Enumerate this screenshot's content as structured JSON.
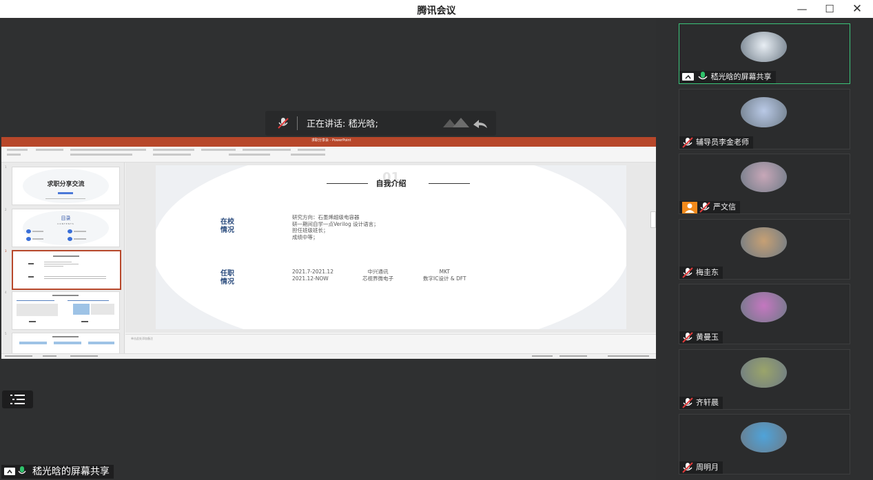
{
  "window": {
    "title": "腾讯会议",
    "controls": {
      "minimize": "—",
      "maximize": "☐",
      "close": "✕"
    }
  },
  "speaking": {
    "text": "正在讲话: 嵇光晗;"
  },
  "presentation": {
    "app_title": "求职分享会 - PowerPoint",
    "tabs": [
      "文件",
      "开始",
      "插入",
      "设计",
      "切换",
      "动画",
      "幻灯片放映",
      "审阅",
      "视图",
      "帮助",
      "操作说明搜索"
    ],
    "thumbnails": [
      {
        "title": "求职分享交流"
      },
      {
        "title": "目录",
        "subtitle": "CONTENTS"
      }
    ],
    "current_slide": {
      "number": "01",
      "heading": "自我介绍",
      "section1": {
        "label_line1": "在校",
        "label_line2": "情况",
        "lines": [
          "研究方向：石墨烯超级电容器",
          "研一期间自学一点Verilog 设计语言；",
          "担任班级班长；",
          "成绩中等；"
        ]
      },
      "section2": {
        "label_line1": "任职",
        "label_line2": "情况",
        "rows": [
          {
            "period": "2021.7-2021.12",
            "company": "中兴通讯",
            "role": "MKT"
          },
          {
            "period": "2021.12-NOW",
            "company": "芯视界微电子",
            "role": "数字IC设计 & DFT"
          }
        ]
      }
    },
    "notes_placeholder": "单击此处添加备注"
  },
  "share_label": "嵇光晗的屏幕共享",
  "participants": [
    {
      "name": "嵇光晗的屏幕共享",
      "muted": false,
      "sharing": true,
      "active": true,
      "avatar_color": "#e8eef4"
    },
    {
      "name": "辅导员李金老师",
      "muted": true,
      "avatar_color": "#b9c9e6"
    },
    {
      "name": "严文信",
      "muted": true,
      "host_badge": true,
      "avatar_color": "#c7a7b8"
    },
    {
      "name": "梅圭东",
      "muted": true,
      "avatar_color": "#c6a074"
    },
    {
      "name": "黄曼玉",
      "muted": true,
      "avatar_color": "#c477c0"
    },
    {
      "name": "齐轩晨",
      "muted": true,
      "avatar_color": "#9aa46a"
    },
    {
      "name": "周明月",
      "muted": true,
      "avatar_color": "#4fa3d9"
    }
  ],
  "colors": {
    "active_border": "#3bc57a",
    "ppt_red": "#b7472a",
    "muted_red": "#e03a3a",
    "mic_green": "#2fc26b"
  }
}
